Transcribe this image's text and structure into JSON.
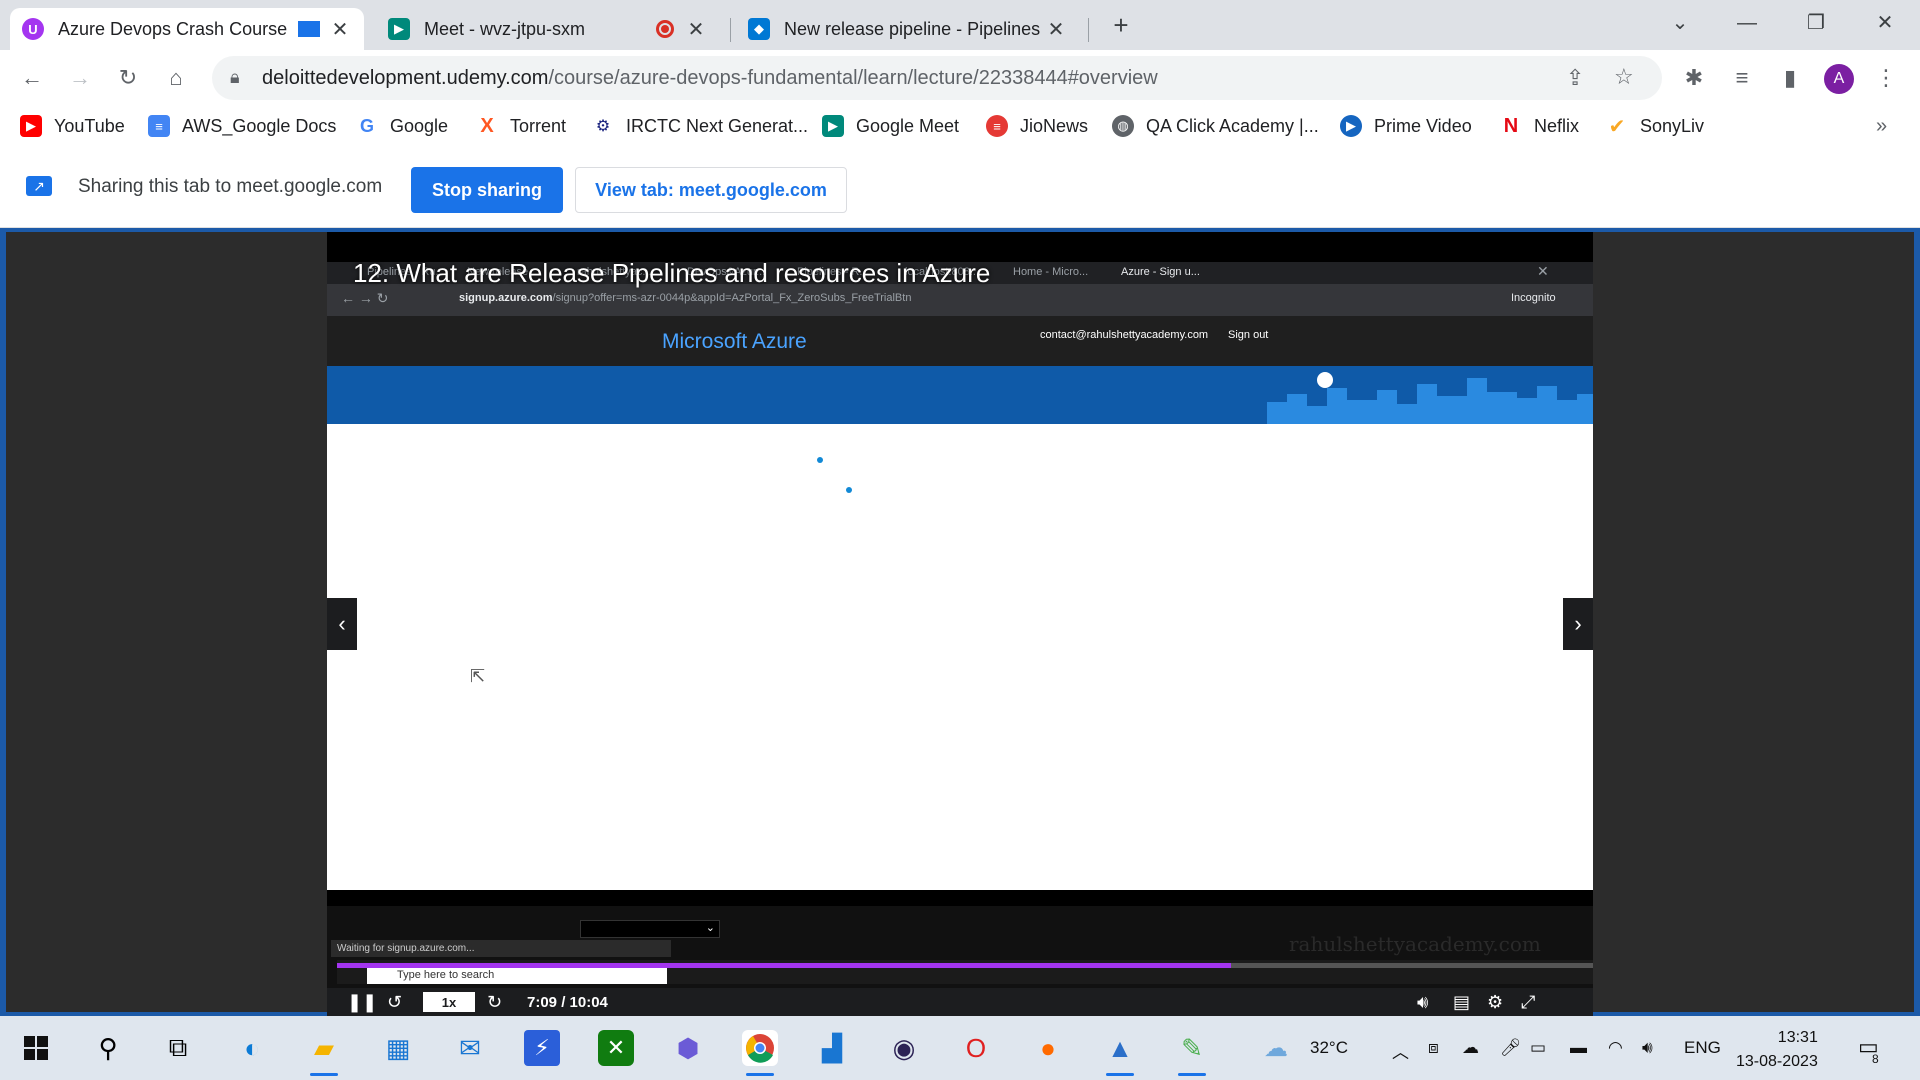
{
  "tabs": [
    {
      "title": "Azure Devops Crash Course",
      "active": true
    },
    {
      "title": "Meet - wvz-jtpu-sxm",
      "active": false
    },
    {
      "title": "New release pipeline - Pipelines",
      "active": false
    }
  ],
  "address_bar": {
    "host": "deloittedevelopment.udemy.com",
    "path": "/course/azure-devops-fundamental/learn/lecture/22338444#overview"
  },
  "bookmarks": [
    {
      "label": "YouTube",
      "icon": "youtube-icon",
      "color": "#ff0000"
    },
    {
      "label": "AWS_Google Docs",
      "icon": "docs-icon",
      "color": "#4285f4"
    },
    {
      "label": "Google",
      "icon": "google-icon",
      "color": "#4285f4"
    },
    {
      "label": "Torrent",
      "icon": "torrent-icon",
      "color": "#ff5722"
    },
    {
      "label": "IRCTC Next Generat...",
      "icon": "irctc-icon",
      "color": "#1a237e"
    },
    {
      "label": "Google Meet",
      "icon": "meet-icon",
      "color": "#00897b"
    },
    {
      "label": "JioNews",
      "icon": "jionews-icon",
      "color": "#e53935"
    },
    {
      "label": "QA Click Academy |...",
      "icon": "globe-icon",
      "color": "#5f6368"
    },
    {
      "label": "Prime Video",
      "icon": "prime-icon",
      "color": "#1565c0"
    },
    {
      "label": "Neflix",
      "icon": "netflix-icon",
      "color": "#e50914"
    },
    {
      "label": "SonyLiv",
      "icon": "sonyliv-icon",
      "color": "#f9a825"
    }
  ],
  "sharebar": {
    "text": "Sharing this tab to meet.google.com",
    "stop_label": "Stop sharing",
    "view_label": "View tab: meet.google.com"
  },
  "video": {
    "lecture_title": "12. What are Release Pipelines and resources in Azure",
    "nested_tabs": [
      "Pipelines - Ru...",
      "New release...",
      "rahulshettyac...",
      "DevOps&Azur...",
      "Pipelines - R...",
      "localhost:808...",
      "Home - Micro...",
      "Azure - Sign u..."
    ],
    "nested_url_host": "signup.azure.com",
    "nested_url_path": "/signup?offer=ms-azr-0044p&appId=AzPortal_Fx_ZeroSubs_FreeTrialBtn",
    "incognito": "Incognito",
    "azure_title": "Microsoft Azure",
    "contact": "contact@rahulshettyacademy.com",
    "signout": "Sign out",
    "status": "Waiting for signup.azure.com...",
    "nested_search": "Type here to search",
    "watermark": "rahulshettyacademy.com",
    "speed": "1x",
    "timecode": "7:09 / 10:04",
    "progress_fraction": 0.712
  },
  "taskbar": {
    "weather": "32°C",
    "lang": "ENG",
    "time": "13:31",
    "date": "13-08-2023",
    "notifications": "8"
  }
}
